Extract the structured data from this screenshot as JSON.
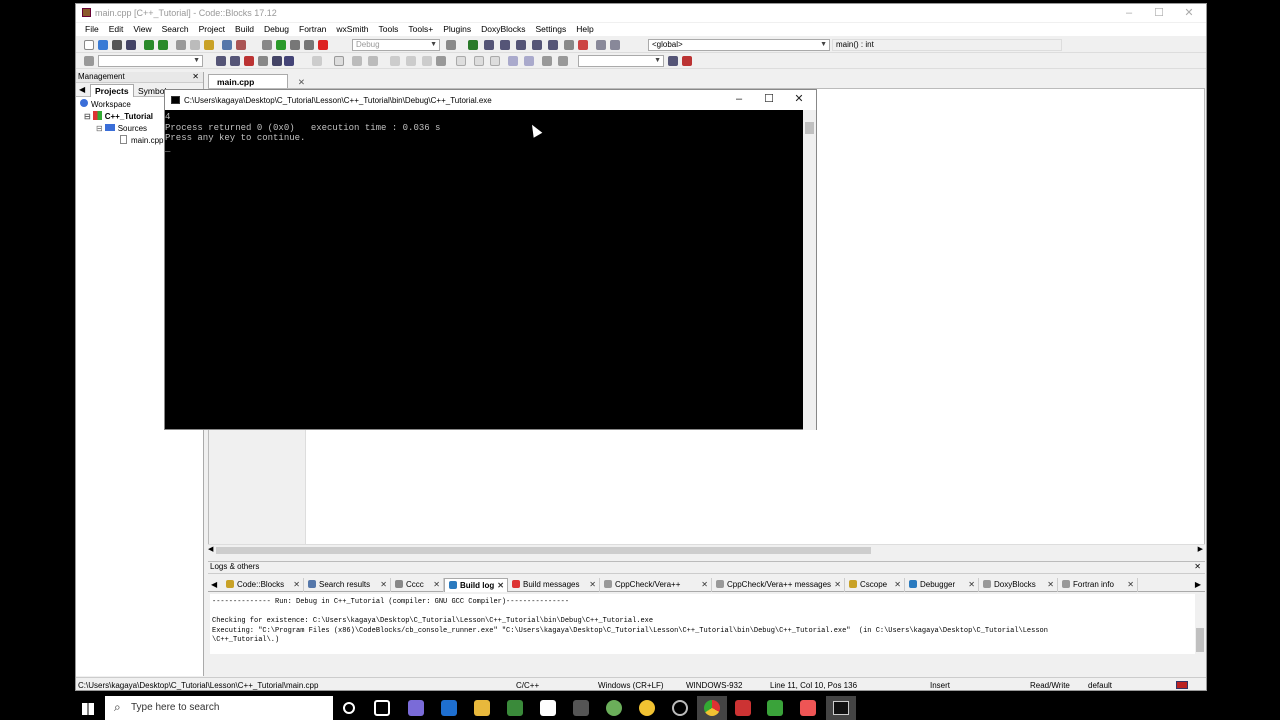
{
  "window": {
    "title": "main.cpp [C++_Tutorial] - Code::Blocks 17.12"
  },
  "menu": [
    "File",
    "Edit",
    "View",
    "Search",
    "Project",
    "Build",
    "Debug",
    "Fortran",
    "wxSmith",
    "Tools",
    "Tools+",
    "Plugins",
    "DoxyBlocks",
    "Settings",
    "Help"
  ],
  "toolbar": {
    "build_target": "Debug",
    "scope": "<global>",
    "function": "main() : int"
  },
  "management": {
    "title": "Management",
    "tabs": [
      "Projects",
      "Symbols"
    ],
    "tree": {
      "workspace": "Workspace",
      "project": "C++_Tutorial",
      "folder": "Sources",
      "file": "main.cpp"
    }
  },
  "editor": {
    "tab": "main.cpp"
  },
  "console": {
    "title": "C:\\Users\\kagaya\\Desktop\\C_Tutorial\\Lesson\\C++_Tutorial\\bin\\Debug\\C++_Tutorial.exe",
    "lines": [
      "4",
      "Process returned 0 (0x0)   execution time : 0.036 s",
      "Press any key to continue.",
      "_"
    ]
  },
  "logs": {
    "title": "Logs & others",
    "tabs": [
      "Code::Blocks",
      "Search results",
      "Cccc",
      "Build log",
      "Build messages",
      "CppCheck/Vera++",
      "CppCheck/Vera++ messages",
      "Cscope",
      "Debugger",
      "DoxyBlocks",
      "Fortran info"
    ],
    "lines": [
      "-------------- Run: Debug in C++_Tutorial (compiler: GNU GCC Compiler)---------------",
      "",
      "Checking for existence: C:\\Users\\kagaya\\Desktop\\C_Tutorial\\Lesson\\C++_Tutorial\\bin\\Debug\\C++_Tutorial.exe",
      "Executing: \"C:\\Program Files (x86)\\CodeBlocks/cb_console_runner.exe\" \"C:\\Users\\kagaya\\Desktop\\C_Tutorial\\Lesson\\C++_Tutorial\\bin\\Debug\\C++_Tutorial.exe\"  (in C:\\Users\\kagaya\\Desktop\\C_Tutorial\\Lesson",
      "\\C++_Tutorial\\.)"
    ]
  },
  "status": {
    "path": "C:\\Users\\kagaya\\Desktop\\C_Tutorial\\Lesson\\C++_Tutorial\\main.cpp",
    "lang": "C/C++",
    "eol": "Windows (CR+LF)",
    "encoding": "WINDOWS-932",
    "position": "Line 11, Col 10, Pos 136",
    "mode": "Insert",
    "access": "Read/Write",
    "profile": "default"
  },
  "taskbar": {
    "search_placeholder": "Type here to search"
  }
}
